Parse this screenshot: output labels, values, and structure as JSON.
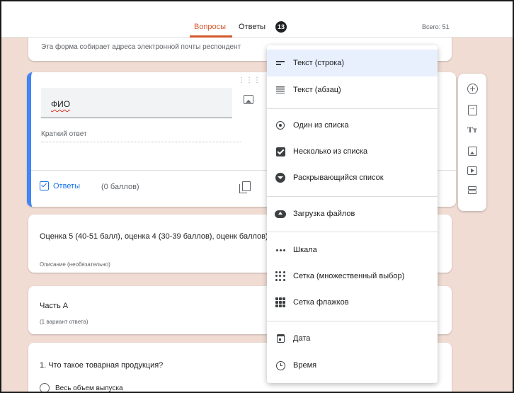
{
  "header": {
    "tab_questions": "Вопросы",
    "tab_answers": "Ответы",
    "answers_count": "13",
    "total": "Всего: 51"
  },
  "email_notice": "Эта форма собирает адреса электронной почты респондент",
  "question_card": {
    "title": "ФИО",
    "answer_placeholder": "Краткий ответ",
    "answers_link": "Ответы",
    "points": "(0 баллов)"
  },
  "desc_card": {
    "text": "Оценка 5 (40-51 балл), оценка 4 (30-39 баллов), оценк баллов).",
    "placeholder": "Описание (необязательно)"
  },
  "part_card": {
    "title": "Часть А",
    "subtitle": "(1 вариант ответа)"
  },
  "q1_card": {
    "title": "1. Что такое товарная продукция?",
    "option1": "Весь объем выпуска"
  },
  "type_menu": {
    "items": [
      {
        "label": "Текст (строка)",
        "icon": "short-text-icon",
        "selected": true
      },
      {
        "label": "Текст (абзац)",
        "icon": "paragraph-icon"
      },
      {
        "label": "Один из списка",
        "icon": "radio-icon"
      },
      {
        "label": "Несколько из списка",
        "icon": "checkbox-icon"
      },
      {
        "label": "Раскрывающийся список",
        "icon": "dropdown-icon"
      },
      {
        "label": "Загрузка файлов",
        "icon": "upload-icon"
      },
      {
        "label": "Шкала",
        "icon": "scale-icon"
      },
      {
        "label": "Сетка (множественный выбор)",
        "icon": "grid-icon"
      },
      {
        "label": "Сетка флажков",
        "icon": "checkbox-grid-icon"
      },
      {
        "label": "Дата",
        "icon": "date-icon"
      },
      {
        "label": "Время",
        "icon": "time-icon"
      }
    ]
  },
  "colors": {
    "accent": "#d4572b",
    "link": "#1a73e8",
    "question_border": "#4285f4",
    "background": "#f0dcd3"
  }
}
